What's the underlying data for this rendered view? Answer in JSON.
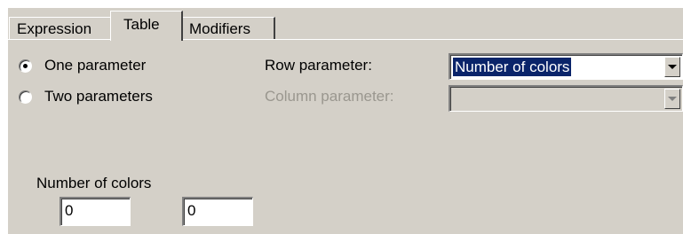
{
  "tabs": {
    "expression": "Expression",
    "table": "Table",
    "modifiers": "Modifiers",
    "active": "Table"
  },
  "parameter_mode": {
    "one_parameter": {
      "label": "One parameter",
      "checked": true
    },
    "two_parameters": {
      "label": "Two parameters",
      "checked": false
    }
  },
  "row_parameter": {
    "label": "Row parameter:",
    "selected": "Number of colors"
  },
  "column_parameter": {
    "label": "Column parameter:",
    "selected": "",
    "enabled": false
  },
  "range": {
    "label": "Number of colors",
    "from": "0",
    "to": "0"
  },
  "colors": {
    "face": "#d4d0c8",
    "selection": "#0a246a",
    "disabled_text": "#9a978f"
  }
}
